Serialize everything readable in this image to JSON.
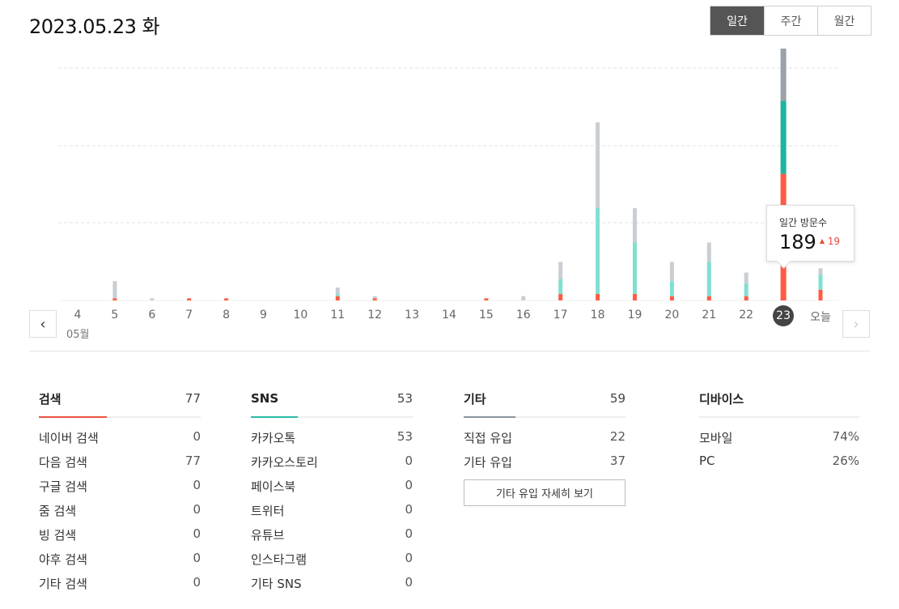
{
  "header": {
    "date_title": "2023.05.23 화"
  },
  "period_tabs": [
    {
      "label": "일간",
      "active": true
    },
    {
      "label": "주간",
      "active": false
    },
    {
      "label": "월간",
      "active": false
    }
  ],
  "chart_data": {
    "type": "bar",
    "stacked": true,
    "categories": [
      "4",
      "5",
      "6",
      "7",
      "8",
      "9",
      "10",
      "11",
      "12",
      "13",
      "14",
      "15",
      "16",
      "17",
      "18",
      "19",
      "20",
      "21",
      "22",
      "23",
      "오늘"
    ],
    "series": [
      {
        "name": "",
        "color": "#ff5a44",
        "values": [
          0,
          1,
          0,
          1,
          1,
          0,
          0,
          2,
          1,
          0,
          0,
          1,
          0,
          3,
          3,
          3,
          2,
          2,
          2,
          59,
          5
        ]
      },
      {
        "name": "",
        "color": "#7fe0d0",
        "values": [
          0,
          0,
          0,
          0,
          0,
          0,
          0,
          1,
          0,
          0,
          0,
          0,
          0,
          7,
          40,
          24,
          7,
          16,
          6,
          34,
          7
        ]
      },
      {
        "name": "",
        "color": "#c9ced3",
        "values": [
          0,
          8,
          1,
          0,
          0,
          0,
          0,
          3,
          1,
          0,
          0,
          0,
          2,
          8,
          40,
          16,
          9,
          9,
          5,
          40,
          3
        ]
      }
    ],
    "selected_index": 19,
    "month_label": "05월",
    "grid": true
  },
  "tooltip": {
    "label": "일간 방문수",
    "value": "189",
    "delta": "19",
    "delta_icon": "up-triangle-icon",
    "delta_color": "#e64b3b"
  },
  "navigation": {
    "prev_icon": "chevron-left-icon",
    "next_icon": "chevron-right-icon"
  },
  "stats": {
    "search": {
      "label": "검색",
      "total": "77",
      "accent": "#e9533f",
      "fill": 0.42,
      "rows": [
        {
          "name": "네이버 검색",
          "value": "0"
        },
        {
          "name": "다음 검색",
          "value": "77"
        },
        {
          "name": "구글 검색",
          "value": "0"
        },
        {
          "name": "줌 검색",
          "value": "0"
        },
        {
          "name": "빙 검색",
          "value": "0"
        },
        {
          "name": "야후 검색",
          "value": "0"
        },
        {
          "name": "기타 검색",
          "value": "0"
        }
      ]
    },
    "sns": {
      "label": "SNS",
      "total": "53",
      "accent": "#2bb9a5",
      "fill": 0.29,
      "rows": [
        {
          "name": "카카오톡",
          "value": "53"
        },
        {
          "name": "카카오스토리",
          "value": "0"
        },
        {
          "name": "페이스북",
          "value": "0"
        },
        {
          "name": "트위터",
          "value": "0"
        },
        {
          "name": "유튜브",
          "value": "0"
        },
        {
          "name": "인스타그램",
          "value": "0"
        },
        {
          "name": "기타 SNS",
          "value": "0"
        }
      ]
    },
    "etc": {
      "label": "기타",
      "total": "59",
      "accent": "#8b949b",
      "fill": 0.32,
      "rows": [
        {
          "name": "직접 유입",
          "value": "22"
        },
        {
          "name": "기타 유입",
          "value": "37"
        }
      ],
      "detail_button": "기타 유입 자세히 보기"
    },
    "device": {
      "label": "디바이스",
      "total": "",
      "rows": [
        {
          "name": "모바일",
          "value": "74%"
        },
        {
          "name": "PC",
          "value": "26%"
        }
      ]
    }
  }
}
